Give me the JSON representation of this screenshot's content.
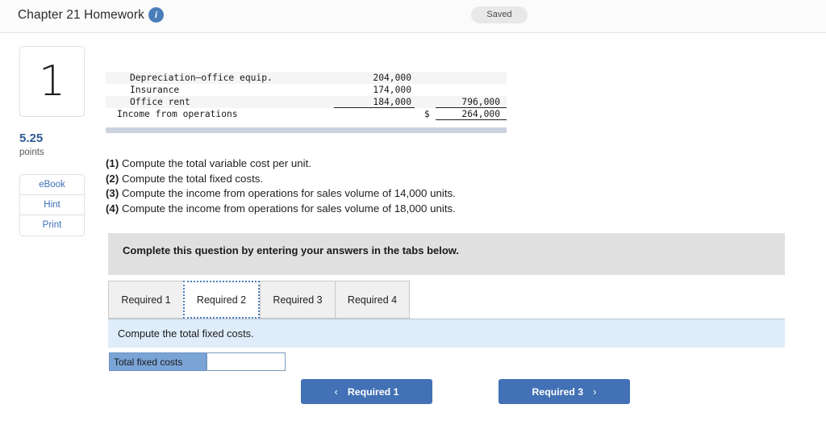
{
  "topbar": {
    "title": "Chapter 21 Homework",
    "info_icon": "info-icon",
    "saved_label": "Saved"
  },
  "sidebar": {
    "question_number": "1",
    "points_value": "5.25",
    "points_label": "points",
    "buttons": [
      {
        "label": "eBook"
      },
      {
        "label": "Hint"
      },
      {
        "label": "Print"
      }
    ]
  },
  "exhibit": {
    "rows": [
      {
        "label": "Depreciation—office equip.",
        "amount1": "204,000",
        "currency": "",
        "amount2": "",
        "indent": 1,
        "stripe": true,
        "rule1": "none",
        "rule2": "none"
      },
      {
        "label": "Insurance",
        "amount1": "174,000",
        "currency": "",
        "amount2": "",
        "indent": 1,
        "stripe": false,
        "rule1": "none",
        "rule2": "none"
      },
      {
        "label": "Office rent",
        "amount1": "184,000",
        "currency": "",
        "amount2": "796,000",
        "indent": 1,
        "stripe": true,
        "rule1": "single",
        "rule2": "single"
      },
      {
        "label": "Income from operations",
        "amount1": "",
        "currency": "$",
        "amount2": "264,000",
        "indent": 0,
        "stripe": false,
        "rule1": "none",
        "rule2": "double"
      }
    ]
  },
  "requirements": [
    {
      "num": "(1)",
      "text": "Compute the total variable cost per unit."
    },
    {
      "num": "(2)",
      "text": "Compute the total fixed costs."
    },
    {
      "num": "(3)",
      "text": "Compute the income from operations for sales volume of 14,000 units."
    },
    {
      "num": "(4)",
      "text": "Compute the income from operations for sales volume of 18,000 units."
    }
  ],
  "complete_banner": {
    "text": "Complete this question by entering your answers in the tabs below."
  },
  "tabs": [
    {
      "label": "Required 1",
      "active": false
    },
    {
      "label": "Required 2",
      "active": true
    },
    {
      "label": "Required 3",
      "active": false
    },
    {
      "label": "Required 4",
      "active": false
    }
  ],
  "sub_prompt": {
    "text": "Compute the total fixed costs."
  },
  "answer": {
    "label": "Total fixed costs",
    "value": "",
    "placeholder": ""
  },
  "nav": {
    "prev": {
      "label": "Required 1",
      "icon": "chevron-left-icon",
      "glyph": "‹"
    },
    "next": {
      "label": "Required 3",
      "icon": "chevron-right-icon",
      "glyph": "›"
    }
  },
  "colors": {
    "accent_blue": "#4271b5",
    "link_blue": "#3d6fb5",
    "label_blue": "#7ba4d6",
    "prompt_blue": "#dfedfa",
    "banner_gray": "#e0e0e0"
  }
}
